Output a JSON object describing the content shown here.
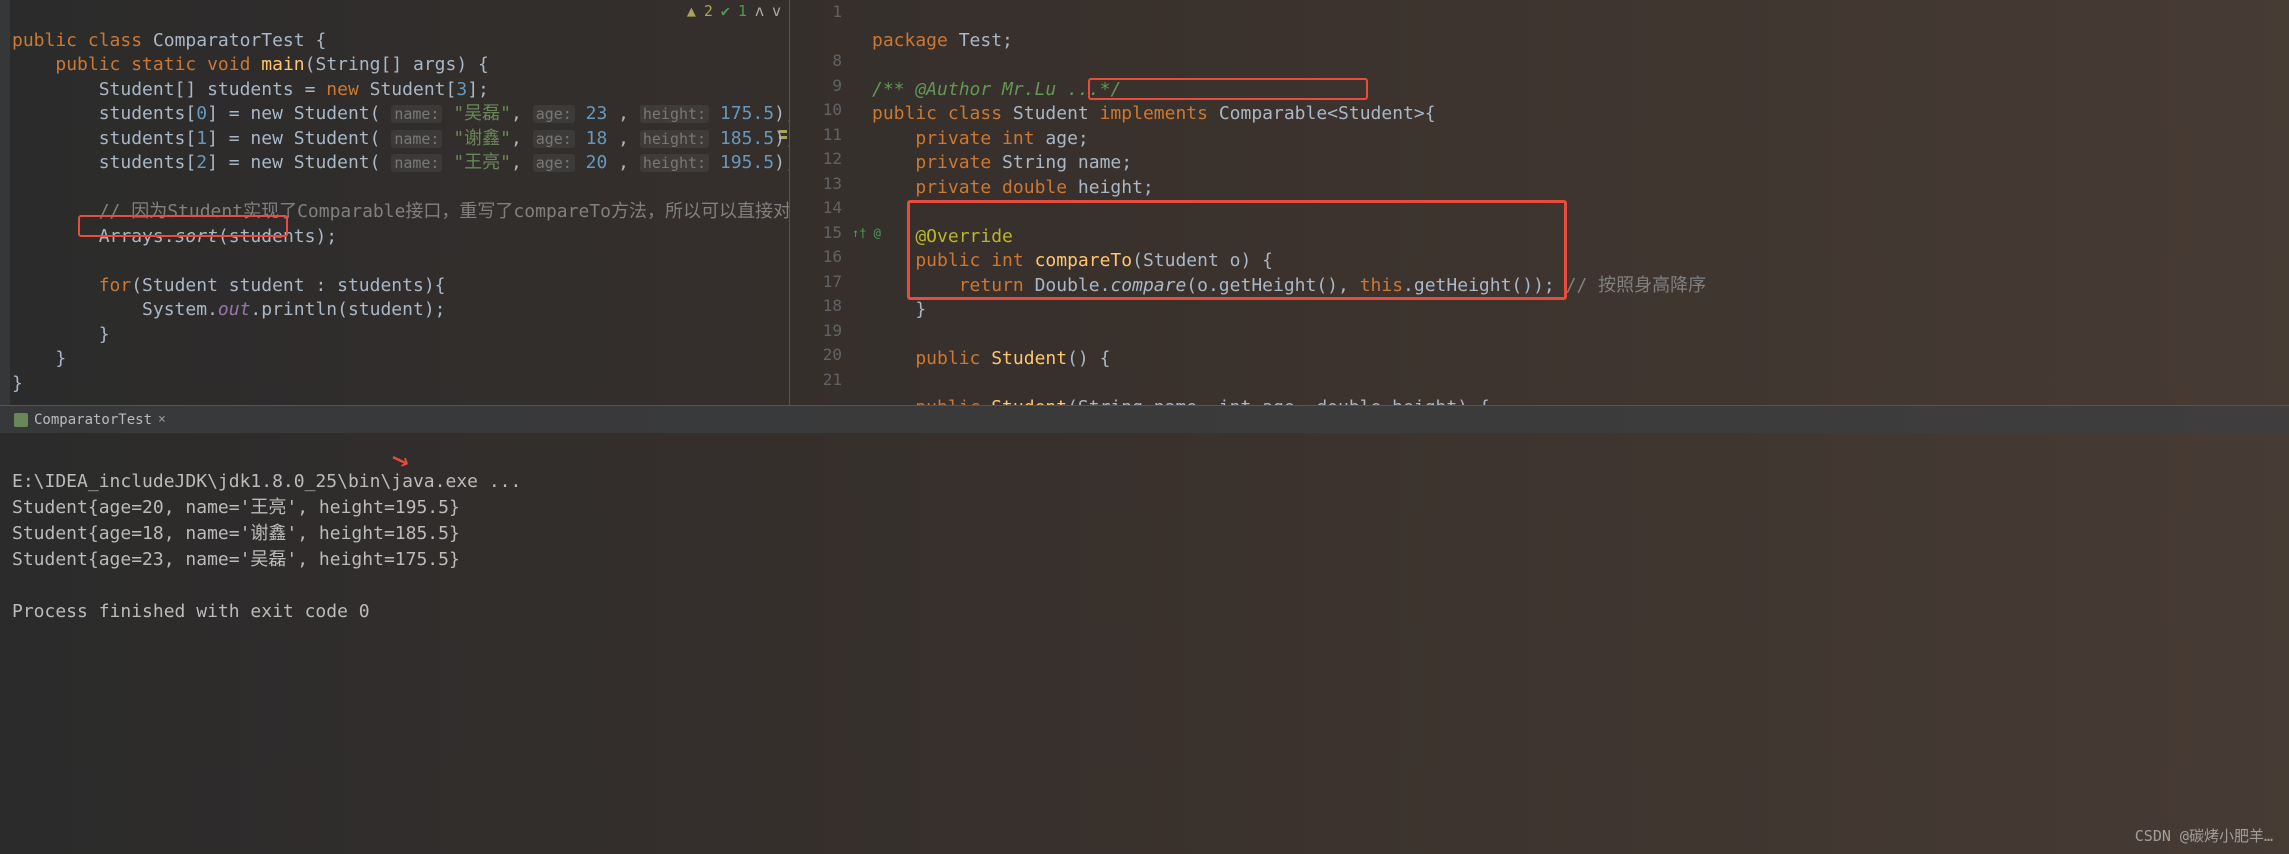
{
  "status": {
    "warnings": "2",
    "passed": "1"
  },
  "left_code": {
    "l1": "public class ComparatorTest {",
    "l2": "    public static void main(String[] args) {",
    "l3": "        Student[] students = new Student[3];",
    "l4_pre": "        students[",
    "l4_idx": "0",
    "l4_mid": "] = new Student( ",
    "l4_p1": "name:",
    "l4_s1": "\"吴磊\"",
    "l4_c1": ", ",
    "l4_p2": "age:",
    "l4_n2": "23",
    "l4_c2": " , ",
    "l4_p3": "height:",
    "l4_n3": "175.5",
    "l4_end": ");",
    "l5_pre": "        students[",
    "l5_idx": "1",
    "l5_mid": "] = new Student( ",
    "l5_p1": "name:",
    "l5_s1": "\"谢鑫\"",
    "l5_c1": ", ",
    "l5_p2": "age:",
    "l5_n2": "18",
    "l5_c2": " , ",
    "l5_p3": "height:",
    "l5_n3": "185.5",
    "l5_end": ");",
    "l6_pre": "        students[",
    "l6_idx": "2",
    "l6_mid": "] = new Student( ",
    "l6_p1": "name:",
    "l6_s1": "\"王亮\"",
    "l6_c1": ", ",
    "l6_p2": "age:",
    "l6_n2": "20",
    "l6_c2": " , ",
    "l6_p3": "height:",
    "l6_n3": "195.5",
    "l6_end": ");",
    "l8": "        // 因为Student实现了Comparable接口，重写了compareTo方法，所以可以直接对student数据进行排序",
    "l9_a": "        Arrays.",
    "l9_b": "sort",
    "l9_c": "(students);",
    "l11": "        for(Student student : students){",
    "l12_a": "            System.",
    "l12_b": "out",
    "l12_c": ".println(student);",
    "l13": "        }",
    "l14": "    }",
    "l15": "}"
  },
  "right_gutter": [
    "1",
    "",
    "8",
    "9",
    "10",
    "11",
    "12",
    "13",
    "14",
    "15",
    "16",
    "17",
    "18",
    "19",
    "20",
    "21"
  ],
  "right_code": {
    "r1": "package Test;",
    "r3": "/** @Author Mr.Lu ...*/",
    "r4_a": "public class ",
    "r4_b": "Student ",
    "r4_c": "implements ",
    "r4_d": "Comparable<Student>",
    "r4_e": "{",
    "r5": "    private int age;",
    "r6": "    private String name;",
    "r7": "    private double height;",
    "r9": "    @Override",
    "r10_a": "    public int ",
    "r10_b": "compareTo",
    "r10_c": "(Student o) {",
    "r11_a": "        return Double.",
    "r11_b": "compare",
    "r11_c": "(o.getHeight(), ",
    "r11_d": "this",
    "r11_e": ".getHeight()); ",
    "r11_f": "// 按照身高降序",
    "r12": "    }",
    "r14_a": "    public ",
    "r14_b": "Student",
    "r14_c": "() {",
    "r16_a": "    public ",
    "r16_b": "Student",
    "r16_c": "(String name, int age, double height) {"
  },
  "console": {
    "tab_name": "ComparatorTest",
    "line1": "E:\\IDEA_includeJDK\\jdk1.8.0_25\\bin\\java.exe ...",
    "line2": "Student{age=20, name='王亮', height=195.5}",
    "line3": "Student{age=18, name='谢鑫', height=185.5}",
    "line4": "Student{age=23, name='吴磊', height=175.5}",
    "line6": "Process finished with exit code 0"
  },
  "watermark": "CSDN @碳烤小肥羊…"
}
